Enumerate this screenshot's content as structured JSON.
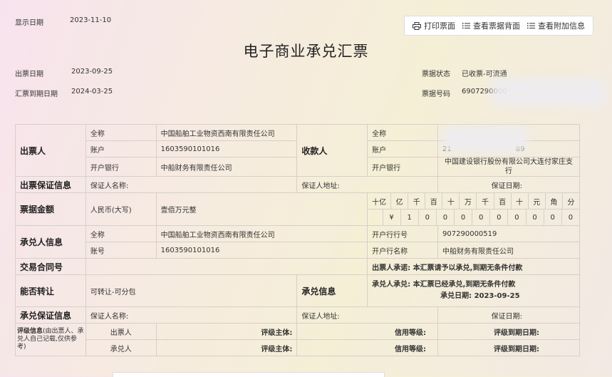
{
  "header": {
    "display_date_label": "显示日期",
    "display_date": "2023-11-10",
    "title": "电子商业承兑汇票",
    "issue_date_label": "出票日期",
    "issue_date": "2023-09-25",
    "due_date_label": "汇票到期日期",
    "due_date": "2024-03-25",
    "status_label": "票据状态",
    "status": "已收票-可流通",
    "bill_no_label": "票据号码",
    "bill_no": "6907290000"
  },
  "toolbar": {
    "print": "打印票面",
    "back": "查看票据背面",
    "extra": "查看附加信息"
  },
  "drawer": {
    "label": "出票人",
    "name_label": "全称",
    "name": "中国船舶工业物资西南有限责任公司",
    "account_label": "账户",
    "account": "1603590101016",
    "bank_label": "开户银行",
    "bank": "中船财务有限责任公司"
  },
  "payee": {
    "label": "收款人",
    "name_label": "全称",
    "name": "",
    "account_label": "账户",
    "account": "21",
    "account_tail": "89",
    "bank_label": "开户银行",
    "bank": "中国建设银行股份有限公司大连付家庄支行"
  },
  "issue_guarantee": {
    "label": "出票保证信息",
    "guarantor_name_label": "保证人名称:",
    "guarantor_addr_label": "保证人地址:",
    "guarantee_date_label": "保证日期:"
  },
  "amount": {
    "label": "票据金额",
    "currency_label": "人民币(大写)",
    "words": "壹佰万元整",
    "units": [
      "十亿",
      "亿",
      "千",
      "百",
      "十",
      "万",
      "千",
      "百",
      "十",
      "元",
      "角",
      "分"
    ],
    "digits": [
      "",
      "¥",
      "1",
      "0",
      "0",
      "0",
      "0",
      "0",
      "0",
      "0",
      "0",
      "0"
    ]
  },
  "acceptor": {
    "label": "承兑人信息",
    "name_label": "全称",
    "name": "中国船舶工业物资西南有限责任公司",
    "account_label": "账号",
    "account": "1603590101016",
    "bank_no_label": "开户行行号",
    "bank_no": "907290000519",
    "bank_name_label": "开户行名称",
    "bank_name": "中船财务有限责任公司"
  },
  "contract": {
    "label": "交易合同号",
    "value": ""
  },
  "transfer": {
    "label": "能否转让",
    "value": "可转让-可分包"
  },
  "acceptance": {
    "label": "承兑信息",
    "drawer_promise_label": "出票人承诺:",
    "drawer_promise": "本汇票请予以承兑,到期无条件付款",
    "acceptor_promise_label": "承兑人承兑:",
    "acceptor_promise": "本汇票已经承兑,到期无条件付款",
    "date_label": "承兑日期:",
    "date": "2023-09-25"
  },
  "accept_guarantee": {
    "label": "承兑保证信息",
    "guarantor_name_label": "保证人名称:",
    "guarantor_addr_label": "保证人地址:",
    "guarantee_date_label": "保证日期:"
  },
  "rating": {
    "label": "评级信息",
    "note": "(由出票人、承兑人自己记载,仅供参考)",
    "rows": [
      {
        "party": "出票人",
        "subject_label": "评级主体:",
        "grade_label": "信用等级:",
        "due_label": "评级到期日期:"
      },
      {
        "party": "承兑人",
        "subject_label": "评级主体:",
        "grade_label": "信用等级:",
        "due_label": "评级到期日期:"
      }
    ]
  }
}
